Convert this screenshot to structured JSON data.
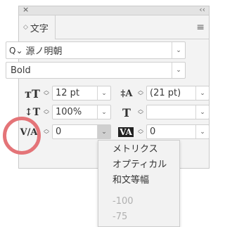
{
  "panel": {
    "tab_label": "文字",
    "font_family": "源ノ明朝",
    "font_style": "Bold",
    "font_size": "12 pt",
    "leading": "(21 pt)",
    "vertical_scale": "100%",
    "horizontal_scale": "",
    "kerning": "0",
    "tracking": "0"
  },
  "kerning_menu": {
    "items": [
      "メトリクス",
      "オプティカル",
      "和文等幅"
    ],
    "numbers": [
      "-100",
      "-75"
    ]
  },
  "colors": {
    "highlight_ring": "#e47478"
  }
}
